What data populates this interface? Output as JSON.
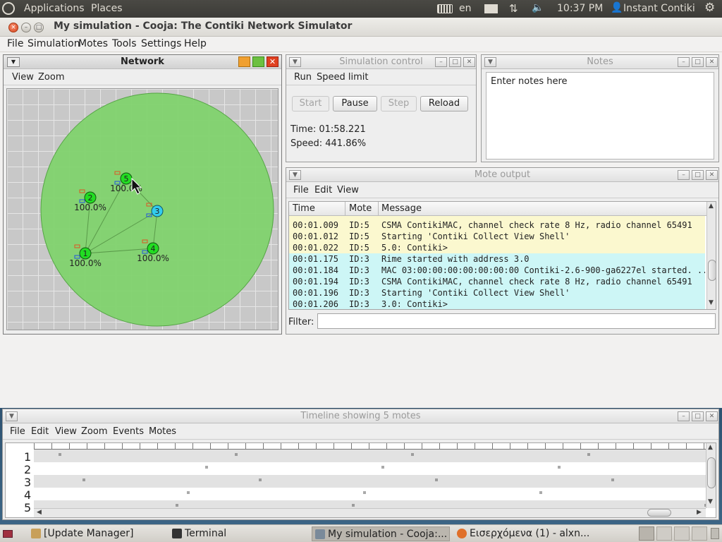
{
  "top_panel": {
    "applications": "Applications",
    "places": "Places",
    "keyboard_icon": "keyboard-icon",
    "language": "en",
    "mail_icon": "mail-icon",
    "network_icon": "network-transfer-icon",
    "volume_icon": "volume-icon",
    "clock": "10:37 PM",
    "user": "Instant Contiki",
    "settings_icon": "gear-icon"
  },
  "window": {
    "title": "My simulation - Cooja: The Contiki Network Simulator",
    "menu": [
      "File",
      "Simulation",
      "Motes",
      "Tools",
      "Settings",
      "Help"
    ]
  },
  "network": {
    "title": "Network",
    "menu": [
      "View",
      "Zoom"
    ],
    "motes": [
      {
        "id": "1",
        "label": "100.0%",
        "color": "#22dd22"
      },
      {
        "id": "2",
        "label": "100.0%",
        "color": "#22dd22"
      },
      {
        "id": "3",
        "label": "",
        "color": "#33ccee"
      },
      {
        "id": "4",
        "label": "100.0%",
        "color": "#22dd22"
      },
      {
        "id": "5",
        "label": "100.0%",
        "color": "#22dd22"
      }
    ]
  },
  "sim_control": {
    "title": "Simulation control",
    "menu": [
      "Run",
      "Speed limit"
    ],
    "buttons": {
      "start": "Start",
      "pause": "Pause",
      "step": "Step",
      "reload": "Reload"
    },
    "time": "Time: 01:58.221",
    "speed": "Speed: 441.86%"
  },
  "notes": {
    "title": "Notes",
    "text": "Enter notes here"
  },
  "mote_output": {
    "title": "Mote output",
    "menu": [
      "File",
      "Edit",
      "View"
    ],
    "columns": [
      "Time",
      "Mote",
      "Message"
    ],
    "rows": [
      {
        "time": "00:01.009",
        "mote": "ID:5",
        "message": "CSMA ContikiMAC, channel check rate 8 Hz, radio channel 65491",
        "color": "#fbf8cf"
      },
      {
        "time": "00:01.012",
        "mote": "ID:5",
        "message": "Starting 'Contiki Collect View Shell'",
        "color": "#fbf8cf"
      },
      {
        "time": "00:01.022",
        "mote": "ID:5",
        "message": "5.0: Contiki>",
        "color": "#fbf8cf"
      },
      {
        "time": "00:01.175",
        "mote": "ID:3",
        "message": "Rime started with address 3.0",
        "color": "#cdf6f6"
      },
      {
        "time": "00:01.184",
        "mote": "ID:3",
        "message": "MAC 03:00:00:00:00:00:00:00 Contiki-2.6-900-ga6227el started. ...",
        "color": "#cdf6f6"
      },
      {
        "time": "00:01.194",
        "mote": "ID:3",
        "message": "CSMA ContikiMAC, channel check rate 8 Hz, radio channel 65491",
        "color": "#cdf6f6"
      },
      {
        "time": "00:01.196",
        "mote": "ID:3",
        "message": "Starting 'Contiki Collect View Shell'",
        "color": "#cdf6f6"
      },
      {
        "time": "00:01.206",
        "mote": "ID:3",
        "message": "3.0: Contiki>",
        "color": "#cdf6f6"
      }
    ],
    "filter_label": "Filter:"
  },
  "timeline": {
    "title": "Timeline showing 5 motes",
    "menu": [
      "File",
      "Edit",
      "View",
      "Zoom",
      "Events",
      "Motes"
    ],
    "rows": [
      "1",
      "2",
      "3",
      "4",
      "5"
    ]
  },
  "taskbar": {
    "items": [
      "[Update Manager]",
      "Terminal",
      "My simulation - Cooja:...",
      "Εισερχόμενα (1) - alxn..."
    ]
  }
}
